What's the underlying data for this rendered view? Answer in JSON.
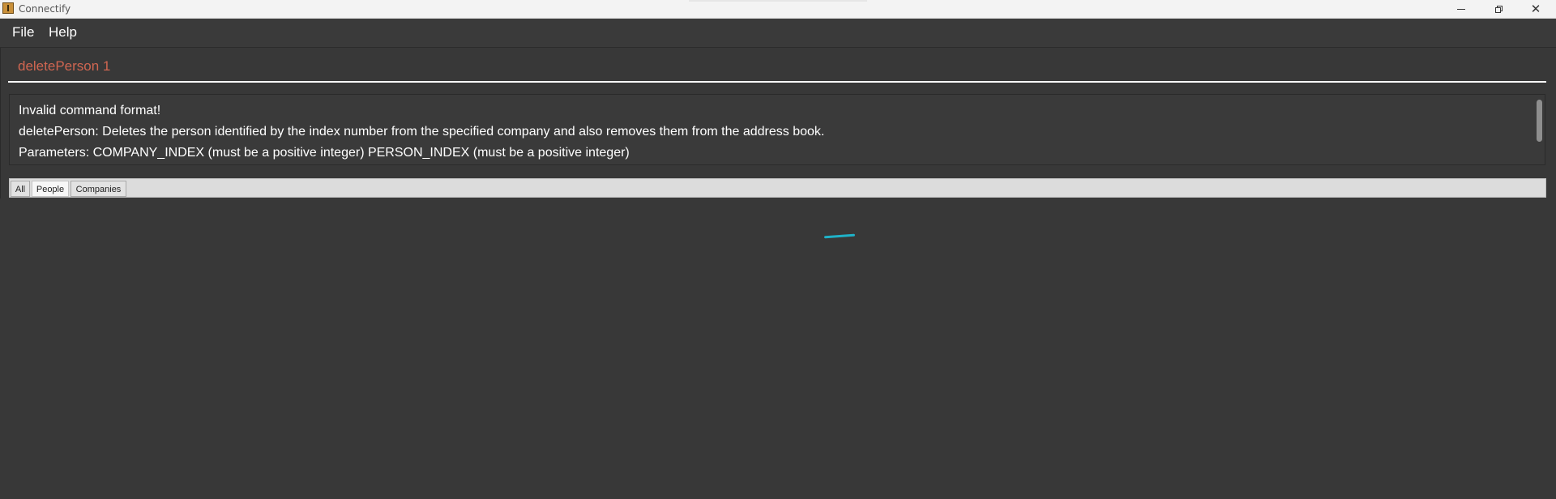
{
  "window": {
    "title": "Connectify"
  },
  "menubar": {
    "items": [
      {
        "label": "File"
      },
      {
        "label": "Help"
      }
    ]
  },
  "command": {
    "value": "deletePerson 1",
    "text_color": "#d06651"
  },
  "result": {
    "lines": [
      "Invalid command format!",
      "deletePerson: Deletes the person identified by the index number from the specified company and also removes them from the address book.",
      "Parameters: COMPANY_INDEX (must be a positive integer) PERSON_INDEX (must be a positive integer)"
    ]
  },
  "tabs": [
    {
      "label": "All",
      "selected": false
    },
    {
      "label": "People",
      "selected": true
    },
    {
      "label": "Companies",
      "selected": false
    }
  ],
  "colors": {
    "background": "#383838",
    "accent": "#1fb2c8"
  }
}
